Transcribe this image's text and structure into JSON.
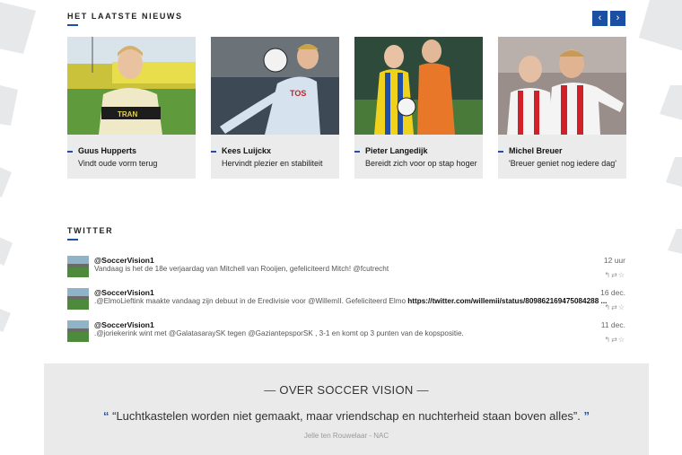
{
  "news": {
    "title": "HET LAATSTE NIEUWS",
    "prev_label": "‹",
    "next_label": "›",
    "items": [
      {
        "name": "Guus Hupperts",
        "headline": "Vindt oude vorm terug"
      },
      {
        "name": "Kees Luijckx",
        "headline": "Hervindt plezier en stabiliteit"
      },
      {
        "name": "Pieter Langedijk",
        "headline": "Bereidt zich voor op stap hoger"
      },
      {
        "name": "Michel Breuer",
        "headline": "'Breuer geniet nog iedere dag'"
      }
    ]
  },
  "twitter": {
    "title": "TWITTER",
    "tweets": [
      {
        "handle": "@SoccerVision1",
        "text": "Vandaag is het de 18e verjaardag van Mitchell van Rooijen, gefeliciteerd Mitch! @fcutrecht",
        "link": "",
        "time": "12 uur"
      },
      {
        "handle": "@SoccerVision1",
        "text": ".@ElmoLieftink maakte vandaag zijn debuut in de Eredivisie voor @WillemII. Gefeliciteerd Elmo ",
        "link": "https://twitter.com/willemii/status/809862169475084288 ...",
        "time": "16 dec."
      },
      {
        "handle": "@SoccerVision1",
        "text": ".@joriekerink wint met @GalatasaraySK tegen @GaziantepsporSK , 3-1 en komt op 3 punten van de kopspositie.",
        "link": "",
        "time": "11 dec."
      }
    ],
    "action_icons": [
      "reply-icon",
      "retweet-icon",
      "favorite-icon"
    ]
  },
  "about": {
    "title": "OVER SOCCER VISION",
    "quote": "“Luchtkastelen worden niet gemaakt, maar vriendschap en nuchterheid staan boven alles”.",
    "author": "Jelle ten Rouwelaar - NAC"
  },
  "colors": {
    "accent": "#1f4fa8",
    "card_bg": "#ebebeb",
    "about_bg": "#eaeaea"
  }
}
